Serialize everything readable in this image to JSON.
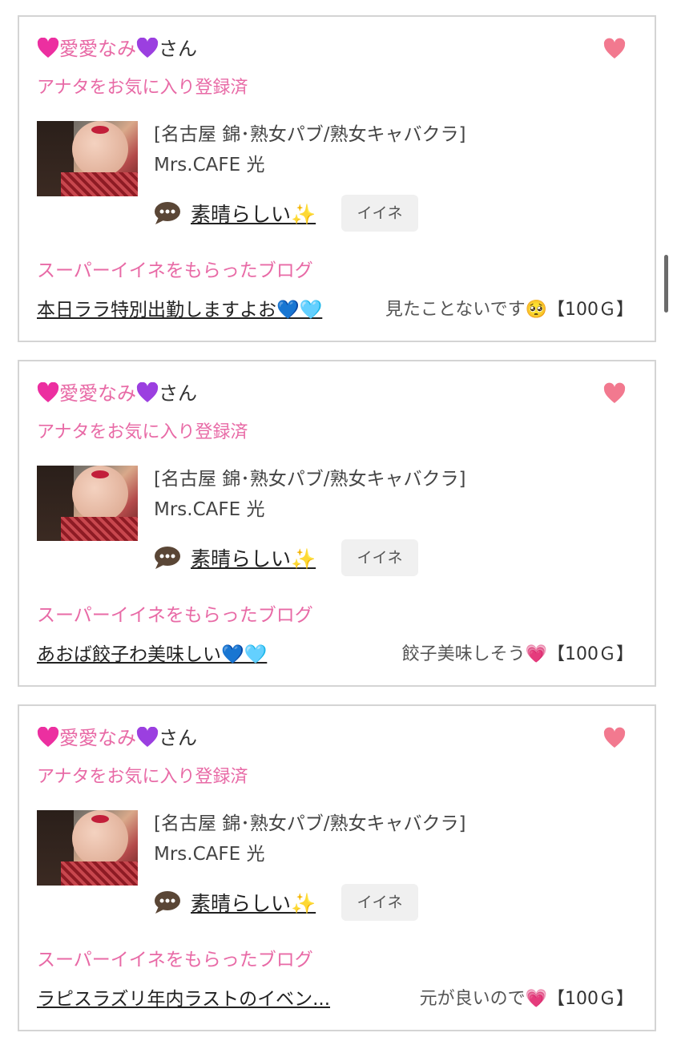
{
  "colors": {
    "accent_pink": "#e86aa6",
    "heart": "#f2798f",
    "border": "#d4d4d4",
    "iine_bg": "#f0f0f0"
  },
  "cards": [
    {
      "user_name": "愛愛なみ",
      "user_suffix": "さん",
      "favorite_status": "アナタをお気に入り登録済",
      "shop_category": "[名古屋 錦･熟女パブ/熟女キャバクラ]",
      "shop_name": "Mrs.CAFE 光",
      "comment": "素晴らしい✨",
      "iine_label": "イイネ",
      "super_label": "スーパーイイネをもらったブログ",
      "blog_title": "本日ララ特別出勤しますよお💙🩵",
      "blog_comment": "見たことないです🥺",
      "points": "【100Ｇ】"
    },
    {
      "user_name": "愛愛なみ",
      "user_suffix": "さん",
      "favorite_status": "アナタをお気に入り登録済",
      "shop_category": "[名古屋 錦･熟女パブ/熟女キャバクラ]",
      "shop_name": "Mrs.CAFE 光",
      "comment": "素晴らしい✨",
      "iine_label": "イイネ",
      "super_label": "スーパーイイネをもらったブログ",
      "blog_title": "あおば餃子わ美味しい💙🩵",
      "blog_comment": "餃子美味しそう💗",
      "points": "【100Ｇ】"
    },
    {
      "user_name": "愛愛なみ",
      "user_suffix": "さん",
      "favorite_status": "アナタをお気に入り登録済",
      "shop_category": "[名古屋 錦･熟女パブ/熟女キャバクラ]",
      "shop_name": "Mrs.CAFE 光",
      "comment": "素晴らしい✨",
      "iine_label": "イイネ",
      "super_label": "スーパーイイネをもらったブログ",
      "blog_title": "ラピスラズリ年内ラストのイベン...",
      "blog_comment": "元が良いので💗",
      "points": "【100Ｇ】"
    }
  ]
}
